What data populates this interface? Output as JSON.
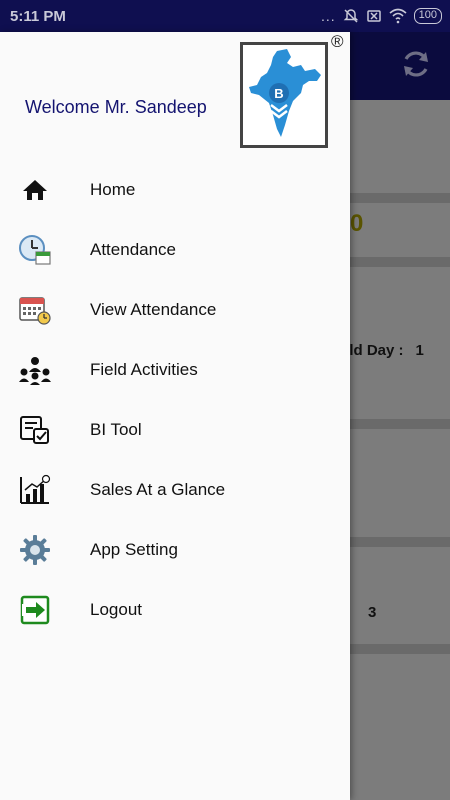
{
  "status_bar": {
    "time": "5:11 PM",
    "dots": "...",
    "battery": "100"
  },
  "drawer": {
    "welcome": "Welcome Mr. Sandeep",
    "logo_letter": "B",
    "registered_mark": "®",
    "menu": [
      {
        "label": "Home",
        "icon": "home-icon"
      },
      {
        "label": "Attendance",
        "icon": "attendance-clock-icon"
      },
      {
        "label": "View Attendance",
        "icon": "calendar-icon"
      },
      {
        "label": "Field Activities",
        "icon": "team-icon"
      },
      {
        "label": "BI Tool",
        "icon": "bi-tool-icon"
      },
      {
        "label": "Sales At a Glance",
        "icon": "sales-chart-icon"
      },
      {
        "label": "App Setting",
        "icon": "gear-icon"
      },
      {
        "label": "Logout",
        "icon": "logout-icon"
      }
    ]
  },
  "background": {
    "value_zero": "0",
    "field_day_label": "eld Day :",
    "field_day_value": "1",
    "count_value": "3"
  },
  "colors": {
    "status_bar": "#0f0f50",
    "toolbar": "#0b0b3e",
    "welcome_text": "#141470",
    "logout_green": "#1e8a1e"
  }
}
